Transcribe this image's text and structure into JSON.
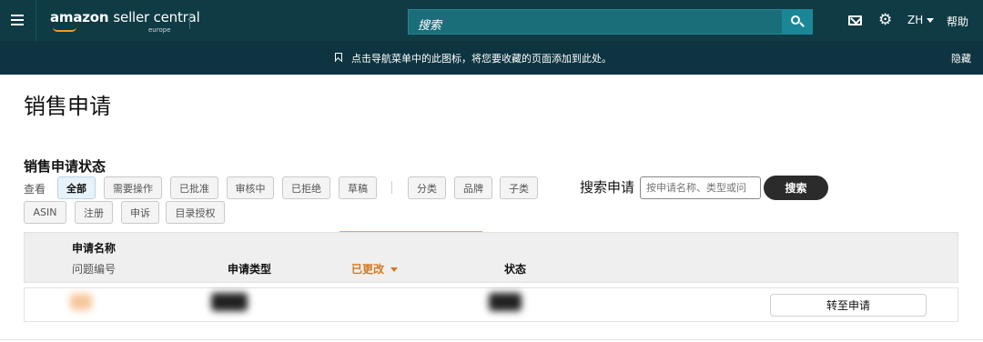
{
  "nav": {
    "logo_brand": "amazon",
    "logo_product": "seller central",
    "logo_region": "europe",
    "search_placeholder": "搜索",
    "language": "ZH",
    "help": "帮助"
  },
  "hint": {
    "text": "点击导航菜单中的此图标，将您要收藏的页面添加到此处。",
    "hide": "隐藏"
  },
  "page": {
    "title": "销售申请"
  },
  "status_section": {
    "title": "销售申请状态",
    "view_label": "查看",
    "filters": [
      "全部",
      "需要操作",
      "已批准",
      "审核中",
      "已拒绝",
      "草稿"
    ],
    "active_filter": "全部",
    "groups": [
      "分类",
      "品牌",
      "子类"
    ],
    "row2": [
      "ASIN",
      "注册",
      "申诉",
      "目录授权"
    ]
  },
  "search": {
    "label": "搜索申请",
    "placeholder": "按申请名称、类型或问",
    "button": "搜索"
  },
  "table": {
    "col_name": "申请名称",
    "col_issue": "问题编号",
    "col_type": "申请类型",
    "col_changed": "已更改",
    "col_status": "状态",
    "row_action": "转至申请"
  },
  "colors": {
    "nav_bg": "#0f3b45",
    "hint_bg": "#0d3440",
    "search_bg": "#1a6e7a",
    "search_btn": "#1b8796",
    "accent_orange": "#d3791f"
  }
}
